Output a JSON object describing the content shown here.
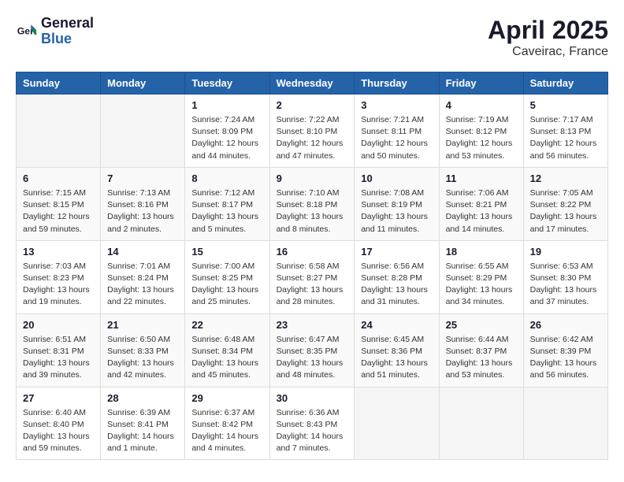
{
  "header": {
    "logo_line1": "General",
    "logo_line2": "Blue",
    "month": "April 2025",
    "location": "Caveirac, France"
  },
  "days_of_week": [
    "Sunday",
    "Monday",
    "Tuesday",
    "Wednesday",
    "Thursday",
    "Friday",
    "Saturday"
  ],
  "weeks": [
    [
      {
        "day": "",
        "info": ""
      },
      {
        "day": "",
        "info": ""
      },
      {
        "day": "1",
        "info": "Sunrise: 7:24 AM\nSunset: 8:09 PM\nDaylight: 12 hours and 44 minutes."
      },
      {
        "day": "2",
        "info": "Sunrise: 7:22 AM\nSunset: 8:10 PM\nDaylight: 12 hours and 47 minutes."
      },
      {
        "day": "3",
        "info": "Sunrise: 7:21 AM\nSunset: 8:11 PM\nDaylight: 12 hours and 50 minutes."
      },
      {
        "day": "4",
        "info": "Sunrise: 7:19 AM\nSunset: 8:12 PM\nDaylight: 12 hours and 53 minutes."
      },
      {
        "day": "5",
        "info": "Sunrise: 7:17 AM\nSunset: 8:13 PM\nDaylight: 12 hours and 56 minutes."
      }
    ],
    [
      {
        "day": "6",
        "info": "Sunrise: 7:15 AM\nSunset: 8:15 PM\nDaylight: 12 hours and 59 minutes."
      },
      {
        "day": "7",
        "info": "Sunrise: 7:13 AM\nSunset: 8:16 PM\nDaylight: 13 hours and 2 minutes."
      },
      {
        "day": "8",
        "info": "Sunrise: 7:12 AM\nSunset: 8:17 PM\nDaylight: 13 hours and 5 minutes."
      },
      {
        "day": "9",
        "info": "Sunrise: 7:10 AM\nSunset: 8:18 PM\nDaylight: 13 hours and 8 minutes."
      },
      {
        "day": "10",
        "info": "Sunrise: 7:08 AM\nSunset: 8:19 PM\nDaylight: 13 hours and 11 minutes."
      },
      {
        "day": "11",
        "info": "Sunrise: 7:06 AM\nSunset: 8:21 PM\nDaylight: 13 hours and 14 minutes."
      },
      {
        "day": "12",
        "info": "Sunrise: 7:05 AM\nSunset: 8:22 PM\nDaylight: 13 hours and 17 minutes."
      }
    ],
    [
      {
        "day": "13",
        "info": "Sunrise: 7:03 AM\nSunset: 8:23 PM\nDaylight: 13 hours and 19 minutes."
      },
      {
        "day": "14",
        "info": "Sunrise: 7:01 AM\nSunset: 8:24 PM\nDaylight: 13 hours and 22 minutes."
      },
      {
        "day": "15",
        "info": "Sunrise: 7:00 AM\nSunset: 8:25 PM\nDaylight: 13 hours and 25 minutes."
      },
      {
        "day": "16",
        "info": "Sunrise: 6:58 AM\nSunset: 8:27 PM\nDaylight: 13 hours and 28 minutes."
      },
      {
        "day": "17",
        "info": "Sunrise: 6:56 AM\nSunset: 8:28 PM\nDaylight: 13 hours and 31 minutes."
      },
      {
        "day": "18",
        "info": "Sunrise: 6:55 AM\nSunset: 8:29 PM\nDaylight: 13 hours and 34 minutes."
      },
      {
        "day": "19",
        "info": "Sunrise: 6:53 AM\nSunset: 8:30 PM\nDaylight: 13 hours and 37 minutes."
      }
    ],
    [
      {
        "day": "20",
        "info": "Sunrise: 6:51 AM\nSunset: 8:31 PM\nDaylight: 13 hours and 39 minutes."
      },
      {
        "day": "21",
        "info": "Sunrise: 6:50 AM\nSunset: 8:33 PM\nDaylight: 13 hours and 42 minutes."
      },
      {
        "day": "22",
        "info": "Sunrise: 6:48 AM\nSunset: 8:34 PM\nDaylight: 13 hours and 45 minutes."
      },
      {
        "day": "23",
        "info": "Sunrise: 6:47 AM\nSunset: 8:35 PM\nDaylight: 13 hours and 48 minutes."
      },
      {
        "day": "24",
        "info": "Sunrise: 6:45 AM\nSunset: 8:36 PM\nDaylight: 13 hours and 51 minutes."
      },
      {
        "day": "25",
        "info": "Sunrise: 6:44 AM\nSunset: 8:37 PM\nDaylight: 13 hours and 53 minutes."
      },
      {
        "day": "26",
        "info": "Sunrise: 6:42 AM\nSunset: 8:39 PM\nDaylight: 13 hours and 56 minutes."
      }
    ],
    [
      {
        "day": "27",
        "info": "Sunrise: 6:40 AM\nSunset: 8:40 PM\nDaylight: 13 hours and 59 minutes."
      },
      {
        "day": "28",
        "info": "Sunrise: 6:39 AM\nSunset: 8:41 PM\nDaylight: 14 hours and 1 minute."
      },
      {
        "day": "29",
        "info": "Sunrise: 6:37 AM\nSunset: 8:42 PM\nDaylight: 14 hours and 4 minutes."
      },
      {
        "day": "30",
        "info": "Sunrise: 6:36 AM\nSunset: 8:43 PM\nDaylight: 14 hours and 7 minutes."
      },
      {
        "day": "",
        "info": ""
      },
      {
        "day": "",
        "info": ""
      },
      {
        "day": "",
        "info": ""
      }
    ]
  ]
}
